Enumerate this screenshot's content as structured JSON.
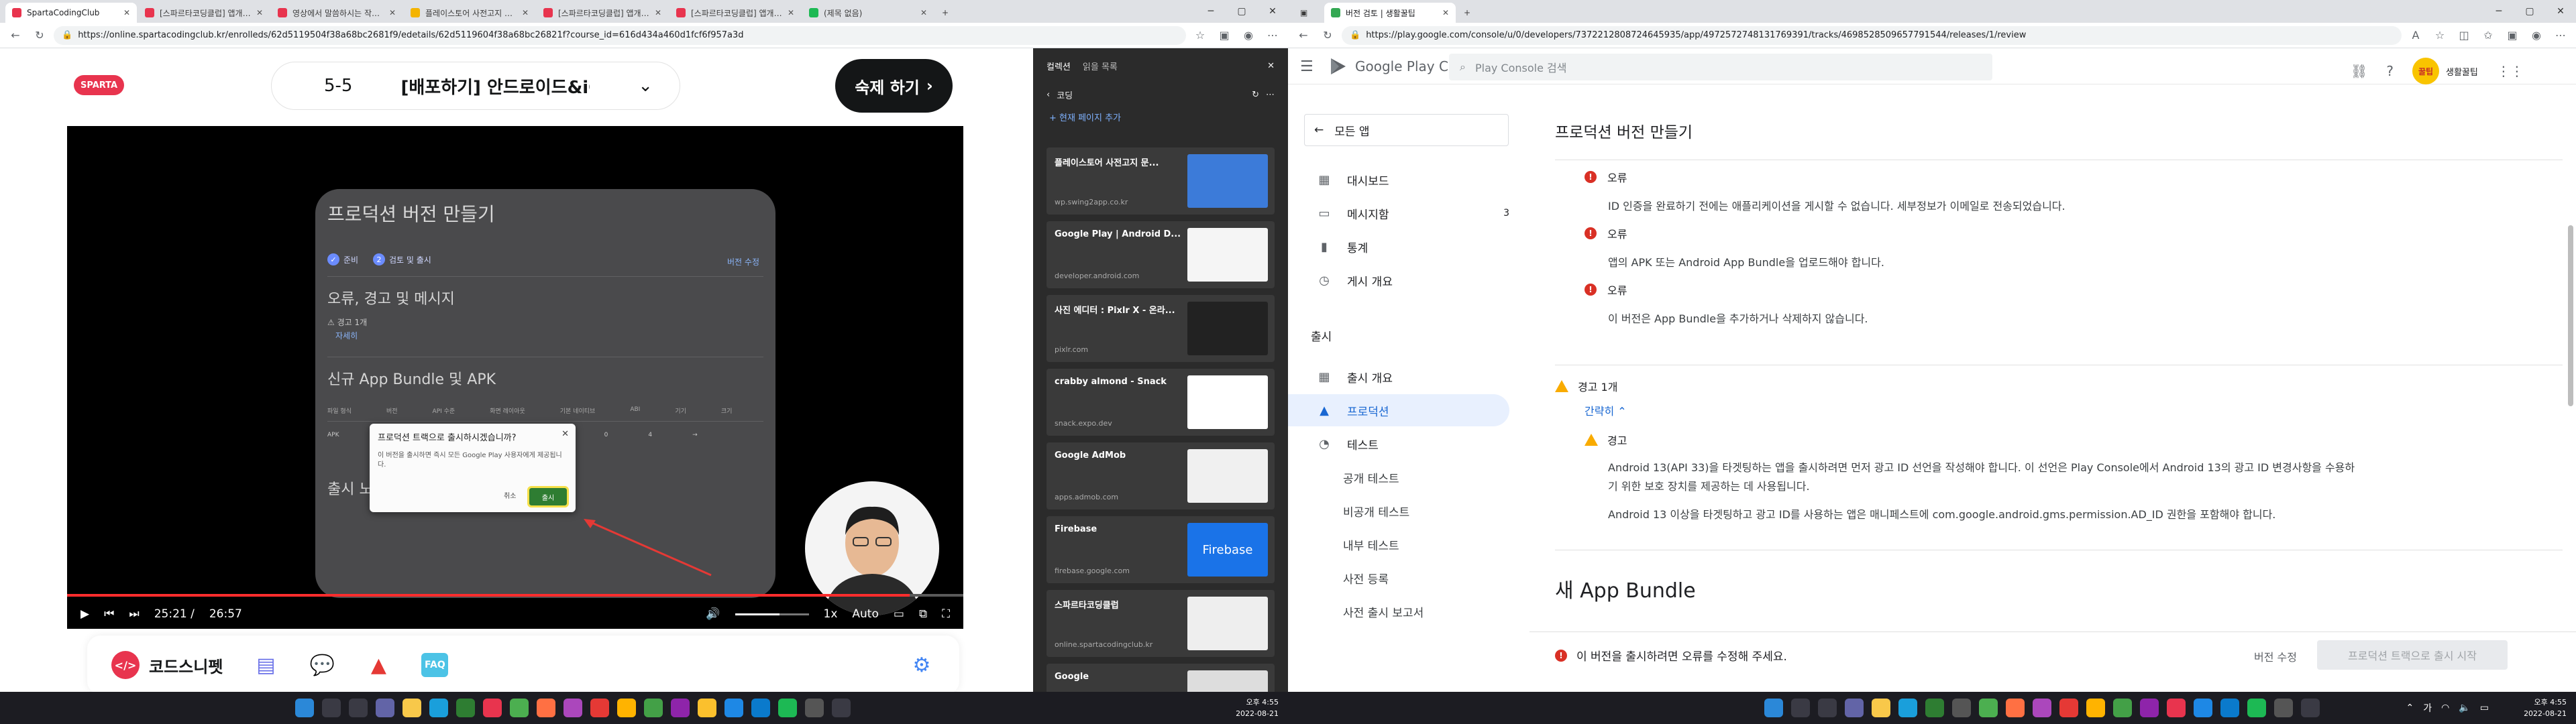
{
  "left_window": {
    "tabs": [
      {
        "title": "SpartaCodingClub",
        "color": "#e8344e",
        "active": true
      },
      {
        "title": "[스파르타코딩클럽] 앱개발 종합반",
        "color": "#e8344e",
        "active": false
      },
      {
        "title": "영상에서 말씀하시는 작성법대로...",
        "color": "#e8344e",
        "active": false
      },
      {
        "title": "플레이스토어 사전고지 문서 제작",
        "color": "#f4b400",
        "active": false
      },
      {
        "title": "[스파르타코딩클럽] 앱개발 종합반",
        "color": "#e8344e",
        "active": false
      },
      {
        "title": "[스파르타코딩클럽] 앱개발 종합반",
        "color": "#e8344e",
        "active": false
      },
      {
        "title": "(제목 없음)",
        "color": "#1db954",
        "active": false
      }
    ],
    "url": "https://online.spartacodingclub.kr/enrolleds/62d5119504f38a68bc2681f9/edetails/62d5119604f38a68bc26821f?course_id=616d434a460d1fcf6f957a3d",
    "logo_text": "SPARTA",
    "lesson_number": "5-5",
    "lesson_title": "[배포하기] 안드로이드&iOS(자료",
    "done_button": "숙제 하기",
    "slide": {
      "title": "프로덕션 버전 만들기",
      "step1": "준비",
      "step2": "검토 및 출시",
      "step2_num": "2",
      "edit_link": "버전 수정",
      "h_errors": "오류, 경고 및 메시지",
      "warn_label": "경고 1개",
      "collapse_link": "자세히",
      "h_bundle": "신규 App Bundle 및 APK",
      "table_headers": [
        "파일 형식",
        "버전",
        "API 수준",
        "화면 레이아웃",
        "기본 네이티브",
        "ABI",
        "기기",
        "크기"
      ],
      "table_row": [
        "APK",
        "1000 (0.1)",
        "16 이상",
        "25",
        "4",
        "0",
        "4",
        "→"
      ],
      "h_notes": "출시 노트"
    },
    "dialog": {
      "title": "프로덕션 트랙으로 출시하시겠습니까?",
      "body": "이 버전을 출시하면 즉시 모든 Google Play 사용자에게 제공됩니다.",
      "cancel": "취소",
      "ok": "출시"
    },
    "player": {
      "current_time": "25:21 /",
      "duration": "26:57",
      "progress": 0.94,
      "volume": 0.6,
      "speed": "1x",
      "quality": "Auto"
    },
    "bottom_nav": {
      "snippet_label": "코드스니펫"
    },
    "collections": {
      "tab_active": "컬렉션",
      "tab_other": "읽을 목록",
      "folder": "코딩",
      "add_current": "+ 현재 페이지 추가",
      "items": [
        {
          "title": "플레이스토어 사전고지 문...",
          "domain": "wp.swing2app.co.kr",
          "thumb": "#3c7bd9"
        },
        {
          "title": "Google Play | Android D...",
          "domain": "developer.android.com",
          "thumb": "#f5f5f5"
        },
        {
          "title": "사진 에디터 : Pixlr X - 온라...",
          "domain": "pixlr.com",
          "thumb": "#222222"
        },
        {
          "title": "crabby almond - Snack",
          "domain": "snack.expo.dev",
          "thumb": "#ffffff"
        },
        {
          "title": "Google AdMob",
          "domain": "apps.admob.com",
          "thumb": "#f0f0f0"
        },
        {
          "title": "Firebase",
          "domain": "firebase.google.com",
          "thumb": "#1a73e8"
        },
        {
          "title": "스파르타코딩클럽",
          "domain": "online.spartacodingclub.kr",
          "thumb": "#eeeeee"
        },
        {
          "title": "Google",
          "domain": "",
          "thumb": "#dddddd"
        }
      ],
      "firebase_label": "Firebase"
    },
    "clock": {
      "time": "오후 4:55",
      "date": "2022-08-21"
    }
  },
  "right_window": {
    "tab_title": "버전 검토 | 생활꿀팁",
    "url": "https://play.google.com/console/u/0/developers/7372212808724645935/app/4972572748131769391/tracks/4698528509657791544/releases/1/review",
    "brand": "Google Play Console",
    "search_placeholder": "Play Console 검색",
    "account": "생활꿀팁",
    "account_avatar": "꿀팁",
    "all_apps": "모든 앱",
    "nav": [
      {
        "label": "대시보드",
        "icon": "▦"
      },
      {
        "label": "메시지함",
        "icon": "▭",
        "count": "3"
      },
      {
        "label": "통계",
        "icon": "▮"
      },
      {
        "label": "게시 개요",
        "icon": "◷"
      }
    ],
    "section_release": "출시",
    "release_nav": [
      {
        "label": "출시 개요",
        "icon": "▦"
      },
      {
        "label": "프로덕션",
        "icon": "▲"
      },
      {
        "label": "테스트",
        "icon": "◔"
      }
    ],
    "test_sub": [
      "공개 테스트",
      "비공개 테스트",
      "내부 테스트",
      "사전 등록",
      "사전 출시 보고서"
    ],
    "page_title": "프로덕션 버전 만들기",
    "errors": [
      {
        "label": "오류",
        "msg": "ID 인증을 완료하기 전에는 애플리케이션을 게시할 수 없습니다. 세부정보가 이메일로 전송되었습니다."
      },
      {
        "label": "오류",
        "msg": "앱의 APK 또는 Android App Bundle을 업로드해야 합니다."
      },
      {
        "label": "오류",
        "msg": "이 버전은 App Bundle을 추가하거나 삭제하지 않습니다."
      }
    ],
    "warning_count": "경고 1개",
    "collapse": "간략히",
    "warning_label": "경고",
    "warning_para1": "Android 13(API 33)을 타겟팅하는 앱을 출시하려면 먼저 광고 ID 선언을 작성해야 합니다. 이 선언은 Play Console에서 Android 13의 광고 ID 변경사항을 수용하기 위한 보호 장치를 제공하는 데 사용됩니다.",
    "warning_para2": "Android 13 이상을 타겟팅하고 광고 ID를 사용하는 앱은 매니페스트에 com.google.android.gms.permission.AD_ID 권한을 포함해야 합니다.",
    "new_bundle": "새 App Bundle",
    "footer_error": "이 버전을 출시하려면 오류를 수정해 주세요.",
    "footer_edit": "버전 수정",
    "footer_button": "프로덕션 트랙으로 출시 시작",
    "clock": {
      "time": "오후 4:55",
      "date": "2022-08-21"
    }
  }
}
